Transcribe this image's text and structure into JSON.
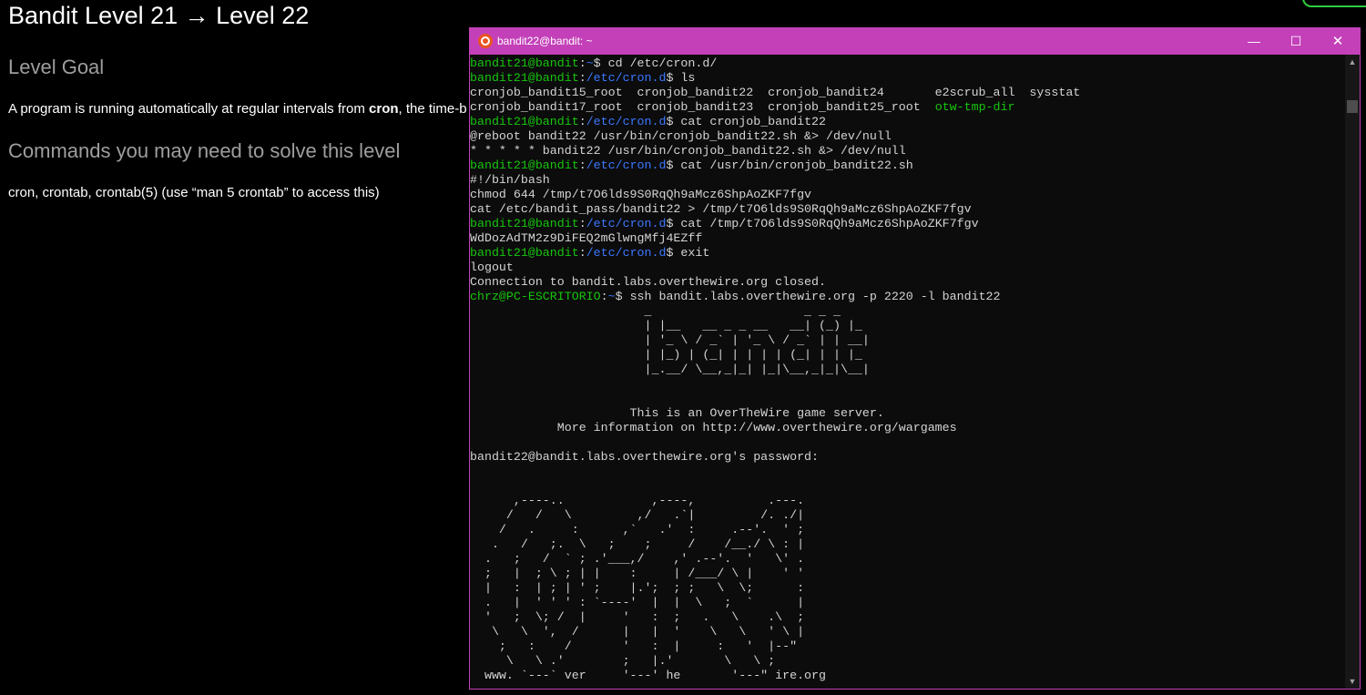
{
  "page": {
    "title": "Bandit Level 21 → Level 22",
    "goal_heading": "Level Goal",
    "goal_text_pre": "A program is running automatically at regular intervals from ",
    "goal_text_bold": "cron",
    "goal_text_post": ", the time-b",
    "commands_heading": "Commands you may need to solve this level",
    "commands_text": "cron, crontab, crontab(5) (use “man 5 crontab” to access this)"
  },
  "terminal": {
    "title": "bandit22@bandit: ~",
    "controls": {
      "minimize": "—",
      "maximize": "☐",
      "close": "✕"
    },
    "lines": [
      [
        [
          "g",
          "bandit21@bandit"
        ],
        [
          "t",
          ":"
        ],
        [
          "b",
          "~"
        ],
        [
          "t",
          "$ cd /etc/cron.d/"
        ]
      ],
      [
        [
          "g",
          "bandit21@bandit"
        ],
        [
          "t",
          ":"
        ],
        [
          "b",
          "/etc/cron.d"
        ],
        [
          "t",
          "$ ls"
        ]
      ],
      [
        [
          "t",
          "cronjob_bandit15_root  cronjob_bandit22  cronjob_bandit24       e2scrub_all  sysstat"
        ]
      ],
      [
        [
          "t",
          "cronjob_bandit17_root  cronjob_bandit23  cronjob_bandit25_root  "
        ],
        [
          "g",
          "otw-tmp-dir"
        ]
      ],
      [
        [
          "g",
          "bandit21@bandit"
        ],
        [
          "t",
          ":"
        ],
        [
          "b",
          "/etc/cron.d"
        ],
        [
          "t",
          "$ cat cronjob_bandit22"
        ]
      ],
      [
        [
          "t",
          "@reboot bandit22 /usr/bin/cronjob_bandit22.sh &> /dev/null"
        ]
      ],
      [
        [
          "t",
          "* * * * * bandit22 /usr/bin/cronjob_bandit22.sh &> /dev/null"
        ]
      ],
      [
        [
          "g",
          "bandit21@bandit"
        ],
        [
          "t",
          ":"
        ],
        [
          "b",
          "/etc/cron.d"
        ],
        [
          "t",
          "$ cat /usr/bin/cronjob_bandit22.sh"
        ]
      ],
      [
        [
          "t",
          "#!/bin/bash"
        ]
      ],
      [
        [
          "t",
          "chmod 644 /tmp/t7O6lds9S0RqQh9aMcz6ShpAoZKF7fgv"
        ]
      ],
      [
        [
          "t",
          "cat /etc/bandit_pass/bandit22 > /tmp/t7O6lds9S0RqQh9aMcz6ShpAoZKF7fgv"
        ]
      ],
      [
        [
          "g",
          "bandit21@bandit"
        ],
        [
          "t",
          ":"
        ],
        [
          "b",
          "/etc/cron.d"
        ],
        [
          "t",
          "$ cat /tmp/t7O6lds9S0RqQh9aMcz6ShpAoZKF7fgv"
        ]
      ],
      [
        [
          "t",
          "WdDozAdTM2z9DiFEQ2mGlwngMfj4EZff"
        ]
      ],
      [
        [
          "g",
          "bandit21@bandit"
        ],
        [
          "t",
          ":"
        ],
        [
          "b",
          "/etc/cron.d"
        ],
        [
          "t",
          "$ exit"
        ]
      ],
      [
        [
          "t",
          "logout"
        ]
      ],
      [
        [
          "t",
          "Connection to bandit.labs.overthewire.org closed."
        ]
      ],
      [
        [
          "g",
          "chrz@PC-ESCRITORIO"
        ],
        [
          "t",
          ":"
        ],
        [
          "b",
          "~"
        ],
        [
          "t",
          "$ ssh bandit.labs.overthewire.org -p 2220 -l bandit22"
        ]
      ],
      [
        [
          "t",
          "                        _                     _ _ _"
        ]
      ],
      [
        [
          "t",
          "                        | |__   __ _ _ __   __| (_) |_"
        ]
      ],
      [
        [
          "t",
          "                        | '_ \\ / _` | '_ \\ / _` | | __|"
        ]
      ],
      [
        [
          "t",
          "                        | |_) | (_| | | | | (_| | | |_"
        ]
      ],
      [
        [
          "t",
          "                        |_.__/ \\__,_|_| |_|\\__,_|_|\\__|"
        ]
      ],
      [
        [
          "t",
          ""
        ]
      ],
      [
        [
          "t",
          ""
        ]
      ],
      [
        [
          "t",
          "                      This is an OverTheWire game server."
        ]
      ],
      [
        [
          "t",
          "            More information on http://www.overthewire.org/wargames"
        ]
      ],
      [
        [
          "t",
          ""
        ]
      ],
      [
        [
          "t",
          "bandit22@bandit.labs.overthewire.org's password:"
        ]
      ],
      [
        [
          "t",
          ""
        ]
      ],
      [
        [
          "t",
          ""
        ]
      ],
      [
        [
          "t",
          "      ,----..            ,----,          .---."
        ]
      ],
      [
        [
          "t",
          "     /   /   \\         ,/   .`|         /. ./|"
        ]
      ],
      [
        [
          "t",
          "    /   .     :      ,`   .'  :     .--'.  ' ;"
        ]
      ],
      [
        [
          "t",
          "   .   /   ;.  \\   ;    ;     /    /__./ \\ : |"
        ]
      ],
      [
        [
          "t",
          "  .   ;   /  ` ; .'___,/    ,' .--'.  '   \\' ."
        ]
      ],
      [
        [
          "t",
          "  ;   |  ; \\ ; | |    :     | /___/ \\ |    ' '"
        ]
      ],
      [
        [
          "t",
          "  |   :  | ; | ' ;    |.';  ; ;   \\  \\;      :"
        ]
      ],
      [
        [
          "t",
          "  .   |  ' ' ' : `----'  |  |  \\   ;  `      |"
        ]
      ],
      [
        [
          "t",
          "  '   ;  \\; /  |     '   :  ;   .   \\    .\\  ;"
        ]
      ],
      [
        [
          "t",
          "   \\   \\  ',  /      |   |  '    \\   \\   ' \\ |"
        ]
      ],
      [
        [
          "t",
          "    ;   :    /       '   :  |     :   '  |--\""
        ]
      ],
      [
        [
          "t",
          "     \\   \\ .'        ;   |.'       \\   \\ ;"
        ]
      ],
      [
        [
          "t",
          "  www. `---` ver     '---' he       '---\" ire.org"
        ]
      ]
    ]
  }
}
